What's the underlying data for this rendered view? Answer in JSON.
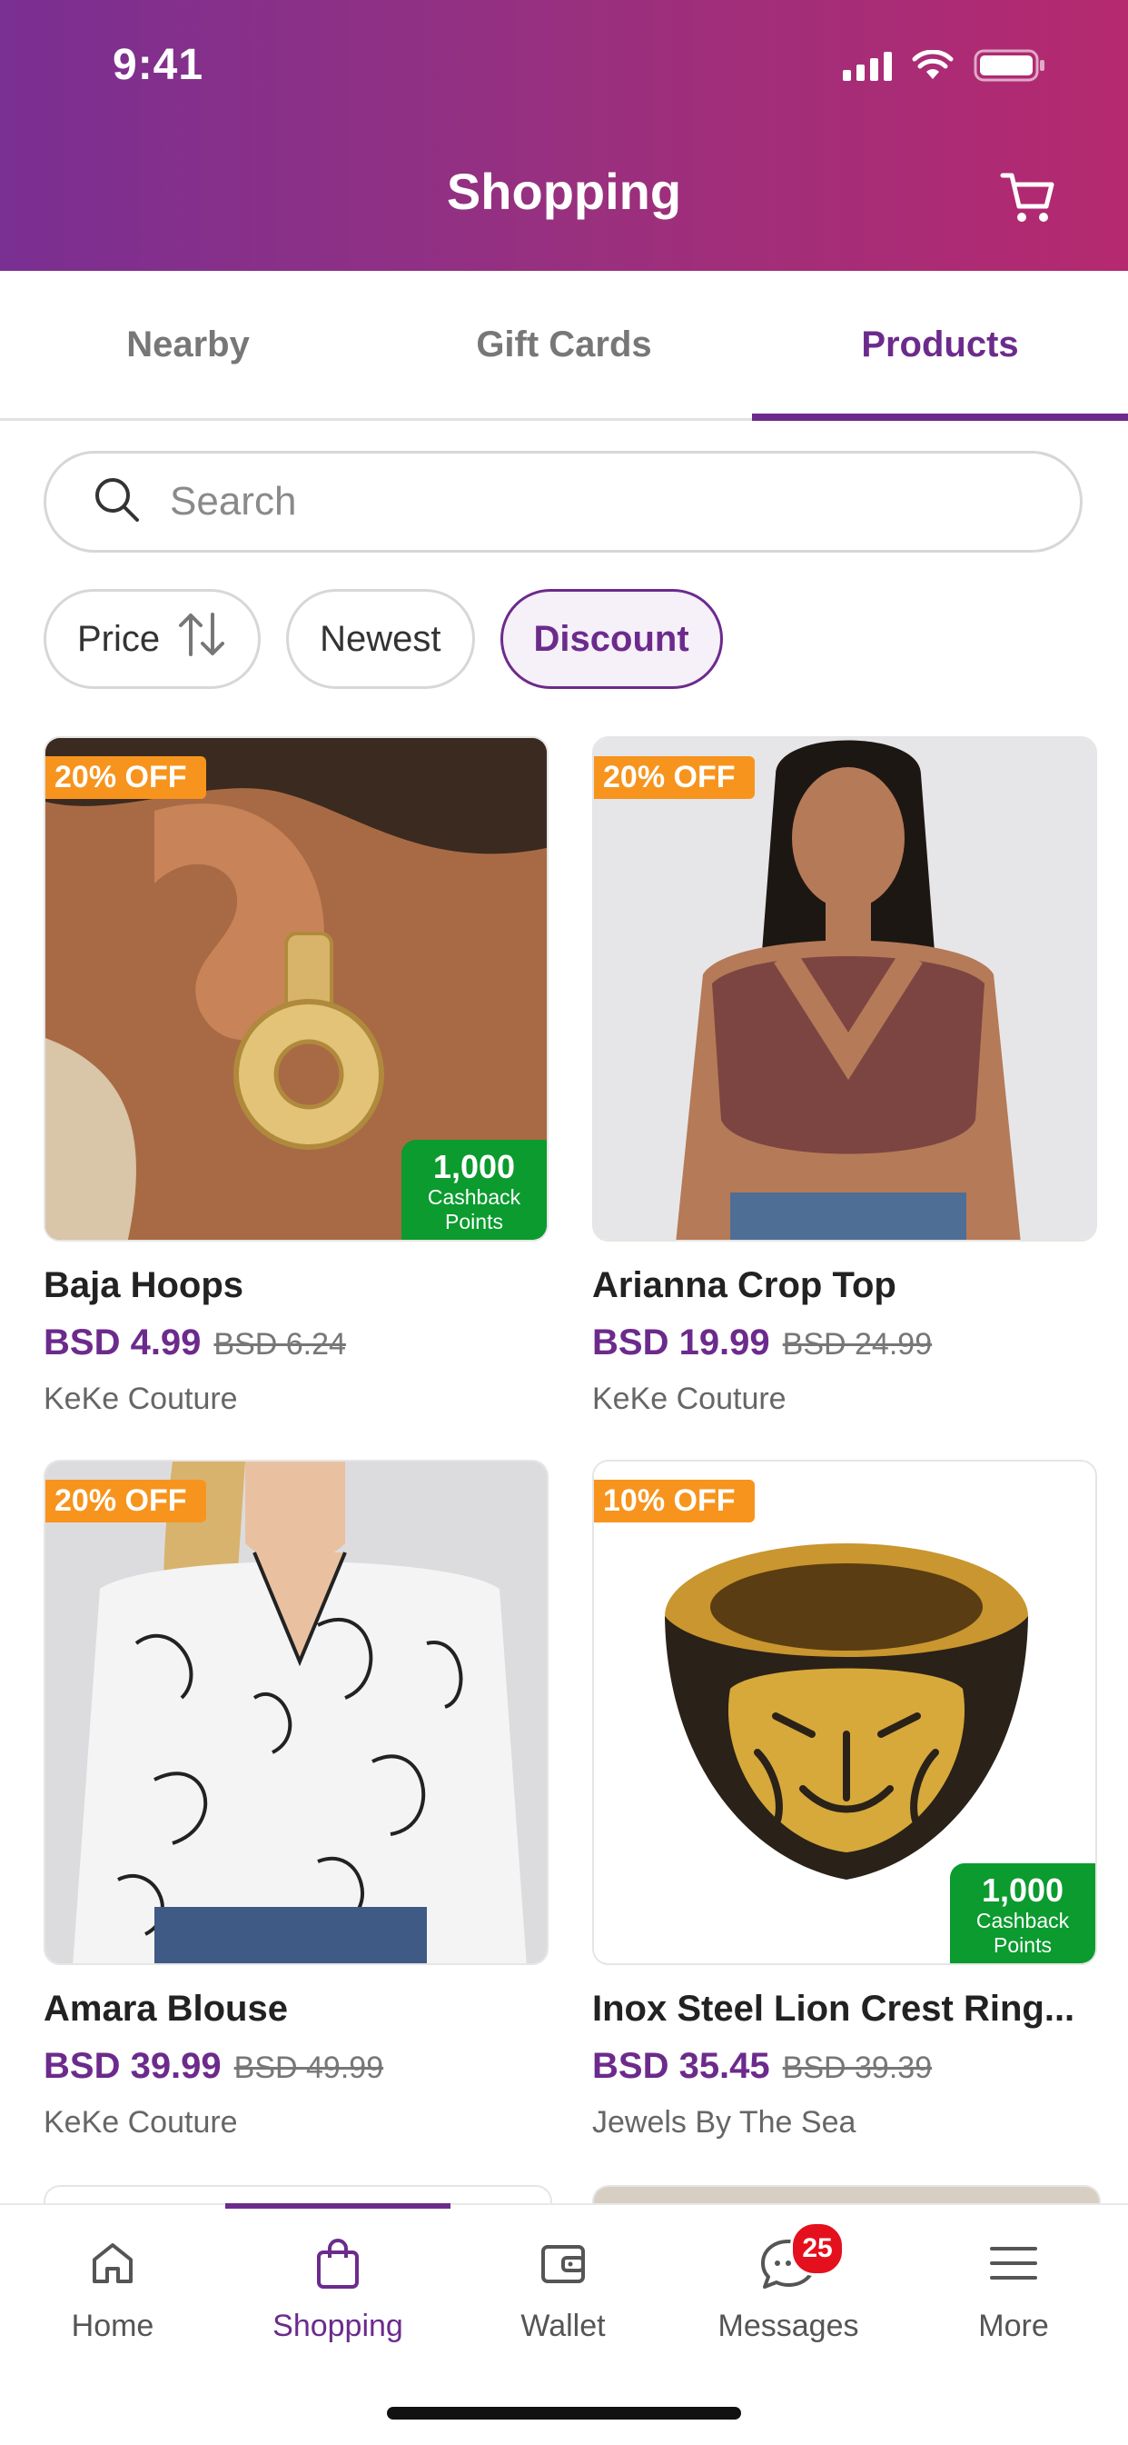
{
  "status": {
    "time": "9:41"
  },
  "header": {
    "title": "Shopping",
    "cart_icon": "cart-icon"
  },
  "tabs": [
    {
      "label": "Nearby",
      "active": false
    },
    {
      "label": "Gift Cards",
      "active": false
    },
    {
      "label": "Products",
      "active": true
    }
  ],
  "search": {
    "placeholder": "Search"
  },
  "filters": [
    {
      "label": "Price",
      "icon": "sort-icon"
    },
    {
      "label": "Newest"
    },
    {
      "label": "Discount",
      "active": true
    }
  ],
  "products": [
    {
      "name": "Baja Hoops",
      "price": "BSD 4.99",
      "old_price": "BSD 6.24",
      "seller": "KeKe Couture",
      "discount": "20% OFF",
      "cashback_points": "1,000",
      "cashback_label_1": "Cashback",
      "cashback_label_2": "Points"
    },
    {
      "name": "Arianna Crop Top",
      "price": "BSD 19.99",
      "old_price": "BSD 24.99",
      "seller": "KeKe Couture",
      "discount": "20% OFF"
    },
    {
      "name": "Amara Blouse",
      "price": "BSD 39.99",
      "old_price": "BSD 49.99",
      "seller": "KeKe Couture",
      "discount": "20% OFF"
    },
    {
      "name": "Inox Steel Lion Crest Ring...",
      "price": "BSD 35.45",
      "old_price": "BSD 39.39",
      "seller": "Jewels By The Sea",
      "discount": "10% OFF",
      "cashback_points": "1,000",
      "cashback_label_1": "Cashback",
      "cashback_label_2": "Points"
    }
  ],
  "bottom_nav": [
    {
      "label": "Home",
      "icon": "home-icon"
    },
    {
      "label": "Shopping",
      "icon": "shopping-bag-icon",
      "active": true
    },
    {
      "label": "Wallet",
      "icon": "wallet-icon"
    },
    {
      "label": "Messages",
      "icon": "messages-icon",
      "badge": "25"
    },
    {
      "label": "More",
      "icon": "menu-icon"
    }
  ],
  "colors": {
    "brand_purple": "#6c2b8c",
    "discount_orange": "#f7941d",
    "cashback_green": "#0b9b2f",
    "badge_red": "#e5101d"
  }
}
